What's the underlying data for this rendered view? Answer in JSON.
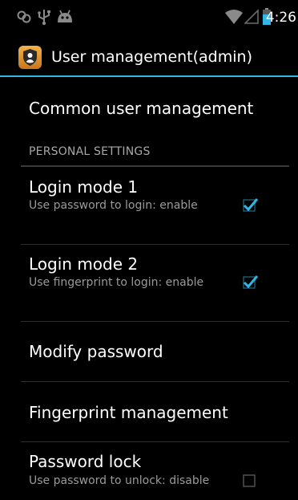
{
  "status_bar": {
    "time": "4:26",
    "icons": [
      "link-icon",
      "usb-icon",
      "android-debug-icon",
      "wifi-icon",
      "no-signal-icon",
      "battery-icon"
    ]
  },
  "action_bar": {
    "icon": "shield-icon",
    "title": "User management(admin)",
    "accent_color": "#33b5e5"
  },
  "items": {
    "common_user_management": {
      "title": "Common user management"
    },
    "section_personal": {
      "label": "PERSONAL SETTINGS"
    },
    "login_mode_1": {
      "title": "Login mode 1",
      "summary": "Use password to login: enable",
      "checked": true
    },
    "login_mode_2": {
      "title": "Login mode 2",
      "summary": "Use fingerprint to login: enable",
      "checked": true
    },
    "modify_password": {
      "title": "Modify password"
    },
    "fingerprint_management": {
      "title": "Fingerprint management"
    },
    "password_lock": {
      "title": "Password lock",
      "summary": "Use password to unlock: disable",
      "checked": false
    }
  },
  "colors": {
    "checkbox_checked": "#33b5e5",
    "summary_text": "#9a9a9a",
    "divider": "#2e2e2e"
  }
}
